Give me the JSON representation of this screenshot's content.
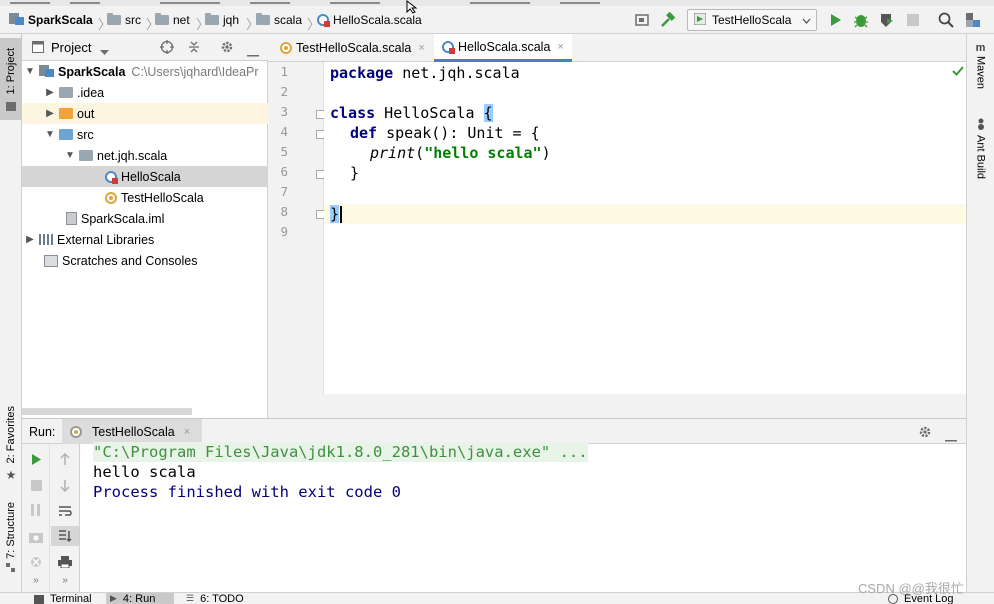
{
  "breadcrumb": [
    {
      "label": "SparkScala",
      "icon": "module-icon"
    },
    {
      "label": "src",
      "icon": "folder-icon"
    },
    {
      "label": "net",
      "icon": "folder-icon"
    },
    {
      "label": "jqh",
      "icon": "folder-icon"
    },
    {
      "label": "scala",
      "icon": "folder-icon"
    },
    {
      "label": "HelloScala.scala",
      "icon": "scala-file-icon"
    }
  ],
  "toolbar": {
    "run_config": "TestHelloScala"
  },
  "left_strip": {
    "project_tab": "1: Project",
    "favorites_tab": "2: Favorites",
    "structure_tab": "7: Structure"
  },
  "right_strip": {
    "maven_tab": "Maven",
    "ant_tab": "Ant Build"
  },
  "project_panel": {
    "title": "Project",
    "tree": [
      {
        "label": "SparkScala",
        "extra": "C:\\Users\\jqhard\\IdeaPr",
        "icon": "module-icon",
        "bold": true
      },
      {
        "label": ".idea",
        "icon": "folder-icon"
      },
      {
        "label": "out",
        "icon": "folder-orange-icon"
      },
      {
        "label": "src",
        "icon": "source-folder-icon"
      },
      {
        "label": "net.jqh.scala",
        "icon": "package-icon"
      },
      {
        "label": "HelloScala",
        "icon": "scala-class-icon"
      },
      {
        "label": "TestHelloScala",
        "icon": "scala-object-icon"
      },
      {
        "label": "SparkScala.iml",
        "icon": "iml-file-icon"
      },
      {
        "label": "External Libraries",
        "icon": "library-icon"
      },
      {
        "label": "Scratches and Consoles",
        "icon": "scratches-icon"
      }
    ]
  },
  "editor": {
    "tabs": [
      {
        "label": "TestHelloScala.scala",
        "icon": "scala-object-icon",
        "close": "×"
      },
      {
        "label": "HelloScala.scala",
        "icon": "scala-class-icon",
        "close": "×"
      }
    ],
    "line_numbers": [
      "1",
      "2",
      "3",
      "4",
      "5",
      "6",
      "7",
      "8",
      "9"
    ],
    "code": {
      "l1_kw": "package",
      "l1_rest": " net.jqh.scala",
      "l3_kw": "class",
      "l3_name": " HelloScala ",
      "l3_brace": "{",
      "l4_kw": "def",
      "l4_rest": " speak(): Unit = {",
      "l5_fn": "print",
      "l5_open": "(",
      "l5_str": "\"hello scala\"",
      "l5_close": ")",
      "l6": "}",
      "l8": "}"
    }
  },
  "run_panel": {
    "label": "Run:",
    "tab": "TestHelloScala",
    "console": [
      "\"C:\\Program Files\\Java\\jdk1.8.0_281\\bin\\java.exe\" ...",
      "hello scala",
      "Process finished with exit code 0"
    ]
  },
  "bottom_bar": {
    "terminal": "Terminal",
    "run": "4: Run",
    "todo": "6: TODO",
    "event_log": "Event Log"
  },
  "watermark": "CSDN @@我很忙",
  "colors": {
    "keyword": "#000080",
    "string": "#008000",
    "active_tab_underline": "#4083c9",
    "run_green": "#3c9a3c"
  }
}
